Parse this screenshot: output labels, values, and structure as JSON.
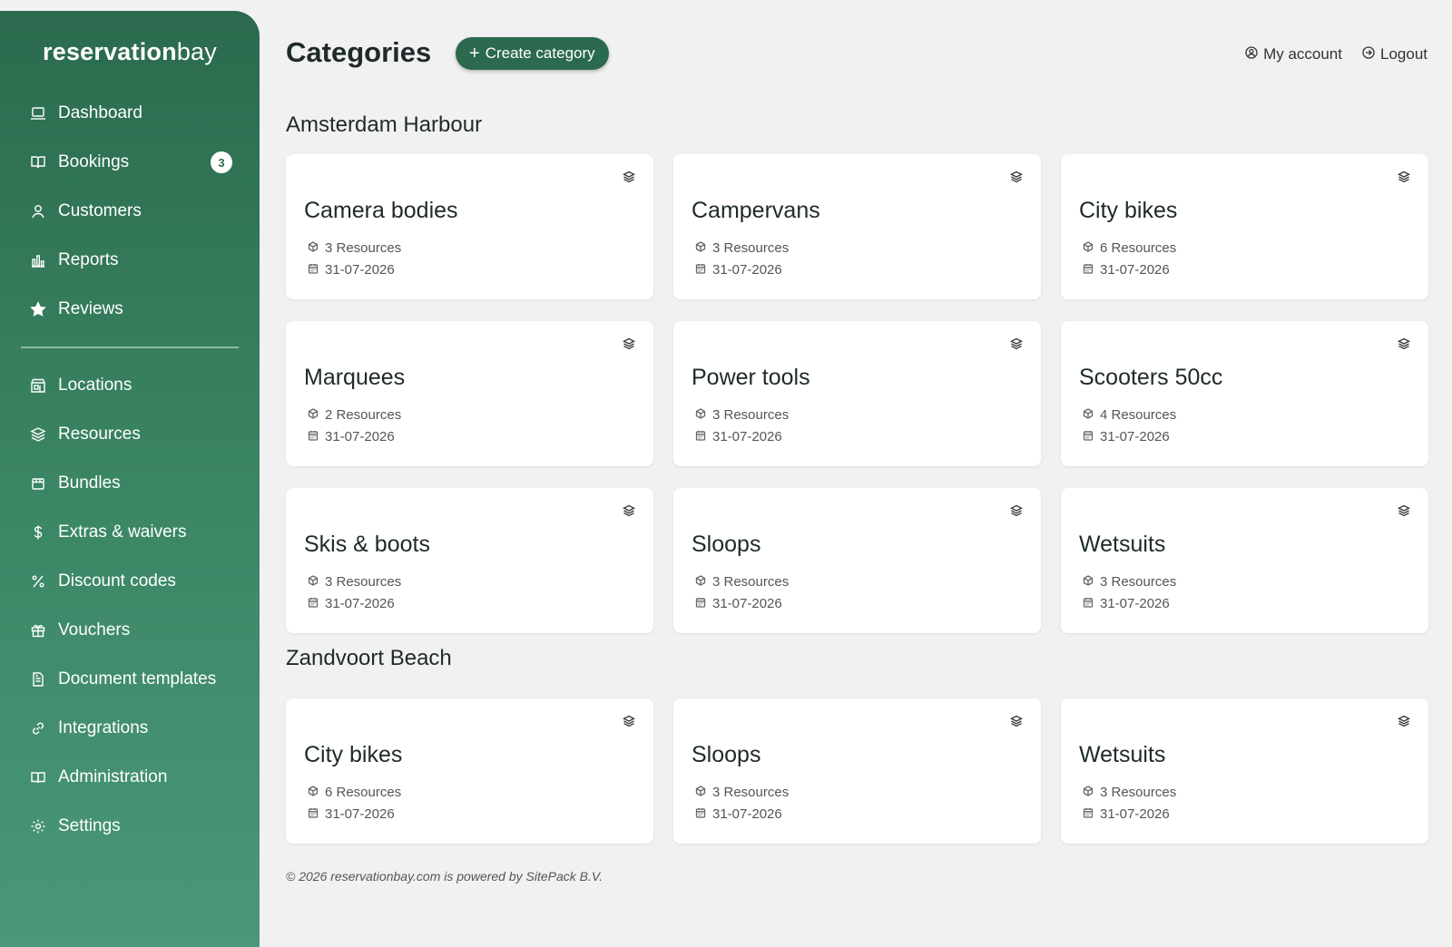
{
  "brand": {
    "part1": "reservation",
    "part2": "bay"
  },
  "sidebar": {
    "primary": [
      {
        "label": "Dashboard",
        "icon": "laptop-icon"
      },
      {
        "label": "Bookings",
        "icon": "book-icon",
        "badge": "3"
      },
      {
        "label": "Customers",
        "icon": "user-icon"
      },
      {
        "label": "Reports",
        "icon": "bar-chart-icon"
      },
      {
        "label": "Reviews",
        "icon": "star-icon"
      }
    ],
    "secondary": [
      {
        "label": "Locations",
        "icon": "store-icon"
      },
      {
        "label": "Resources",
        "icon": "layers-icon"
      },
      {
        "label": "Bundles",
        "icon": "package-icon"
      },
      {
        "label": "Extras & waivers",
        "icon": "dollar-icon"
      },
      {
        "label": "Discount codes",
        "icon": "percent-icon"
      },
      {
        "label": "Vouchers",
        "icon": "gift-icon"
      },
      {
        "label": "Document templates",
        "icon": "document-icon"
      },
      {
        "label": "Integrations",
        "icon": "link-icon"
      },
      {
        "label": "Administration",
        "icon": "book-open-icon"
      },
      {
        "label": "Settings",
        "icon": "gear-icon"
      }
    ]
  },
  "header": {
    "title": "Categories",
    "create_label": "Create category",
    "my_account": "My account",
    "logout": "Logout"
  },
  "sections": [
    {
      "title": "Amsterdam Harbour",
      "cards": [
        {
          "name": "Camera bodies",
          "resources": "3 Resources",
          "date": "31-07-2026"
        },
        {
          "name": "Campervans",
          "resources": "3 Resources",
          "date": "31-07-2026"
        },
        {
          "name": "City bikes",
          "resources": "6 Resources",
          "date": "31-07-2026"
        },
        {
          "name": "Marquees",
          "resources": "2 Resources",
          "date": "31-07-2026"
        },
        {
          "name": "Power tools",
          "resources": "3 Resources",
          "date": "31-07-2026"
        },
        {
          "name": "Scooters 50cc",
          "resources": "4 Resources",
          "date": "31-07-2026"
        },
        {
          "name": "Skis & boots",
          "resources": "3 Resources",
          "date": "31-07-2026"
        },
        {
          "name": "Sloops",
          "resources": "3 Resources",
          "date": "31-07-2026"
        },
        {
          "name": "Wetsuits",
          "resources": "3 Resources",
          "date": "31-07-2026"
        }
      ]
    },
    {
      "title": "Zandvoort Beach",
      "cards": [
        {
          "name": "City bikes",
          "resources": "6 Resources",
          "date": "31-07-2026"
        },
        {
          "name": "Sloops",
          "resources": "3 Resources",
          "date": "31-07-2026"
        },
        {
          "name": "Wetsuits",
          "resources": "3 Resources",
          "date": "31-07-2026"
        }
      ]
    }
  ],
  "footer": "© 2026 reservationbay.com is powered by SitePack B.V.",
  "colors": {
    "accent": "#2b6a4e",
    "background": "#f1f1f1",
    "card": "#ffffff"
  }
}
